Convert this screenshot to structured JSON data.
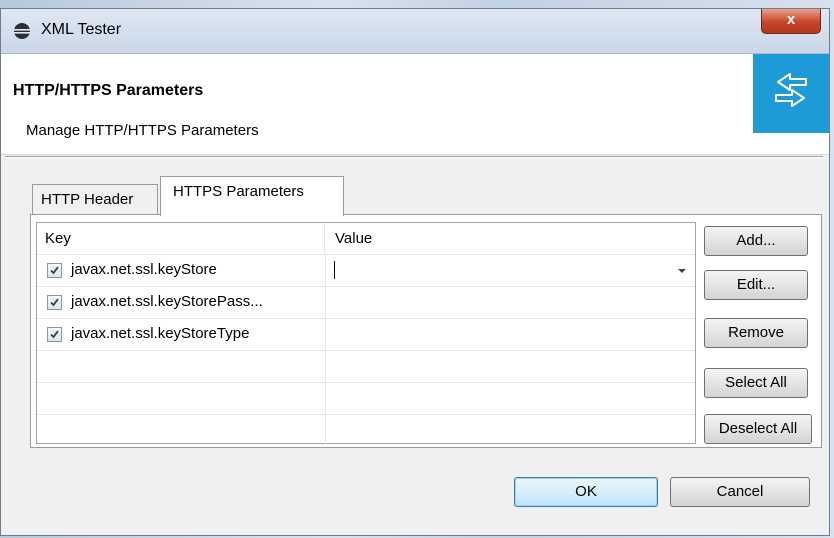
{
  "window": {
    "title": "XML Tester",
    "close_label": "x"
  },
  "header": {
    "title": "HTTP/HTTPS Parameters",
    "subtitle": "Manage HTTP/HTTPS Parameters",
    "icon": "transfer-arrows-icon"
  },
  "tabs": [
    {
      "label": "HTTP Header",
      "active": false
    },
    {
      "label": "HTTPS Parameters",
      "active": true
    }
  ],
  "table": {
    "columns": [
      "Key",
      "Value"
    ],
    "rows": [
      {
        "checked": true,
        "key": "javax.net.ssl.keyStore",
        "value": ""
      },
      {
        "checked": true,
        "key": "javax.net.ssl.keyStorePass...",
        "value": ""
      },
      {
        "checked": true,
        "key": "javax.net.ssl.keyStoreType",
        "value": ""
      }
    ]
  },
  "side_buttons": {
    "add": "Add...",
    "edit": "Edit...",
    "remove": "Remove",
    "select_all": "Select All",
    "deselect_all": "Deselect All"
  },
  "footer": {
    "ok": "OK",
    "cancel": "Cancel"
  },
  "colors": {
    "accent": "#1e9ad6",
    "close": "#c7442b"
  }
}
